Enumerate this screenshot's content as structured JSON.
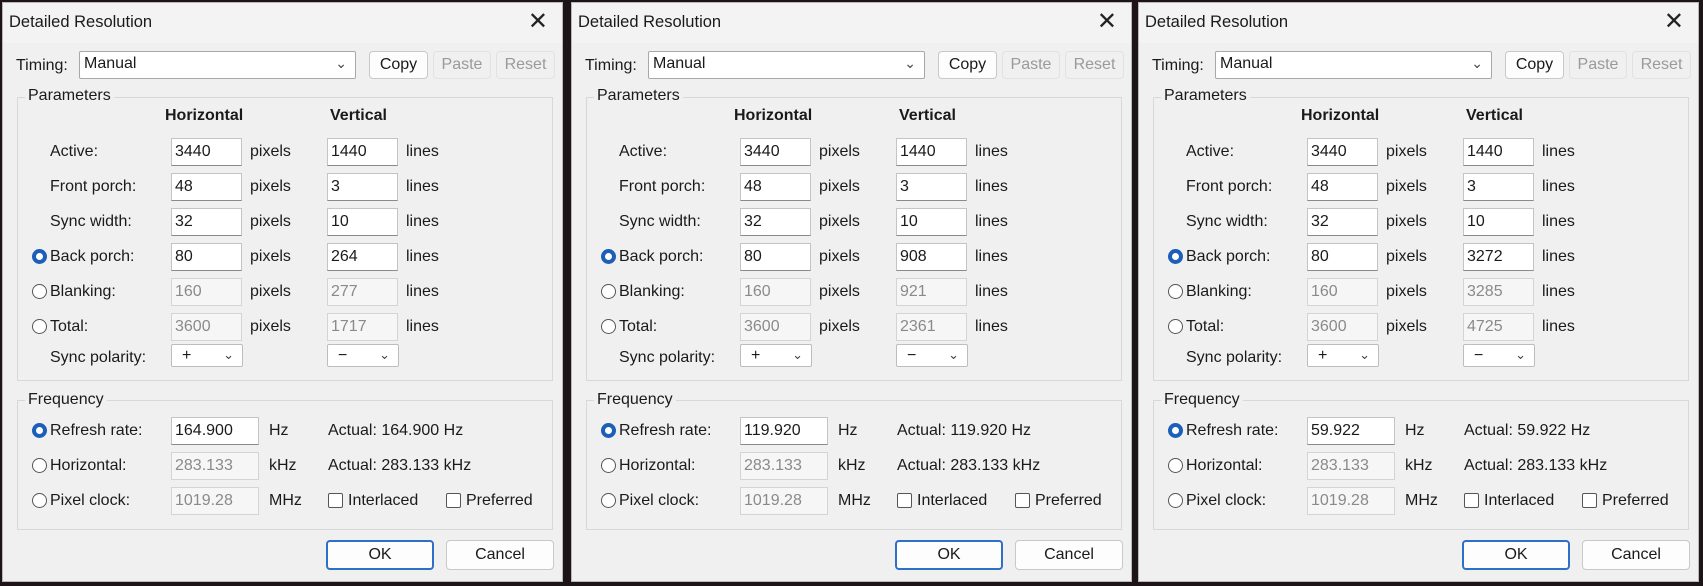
{
  "dialogs": [
    {
      "title": "Detailed Resolution",
      "timing": {
        "label": "Timing:",
        "value": "Manual"
      },
      "buttons": {
        "copy": "Copy",
        "paste": "Paste",
        "reset": "Reset",
        "ok": "OK",
        "cancel": "Cancel"
      },
      "parameters": {
        "title": "Parameters",
        "col_h": "Horizontal",
        "col_v": "Vertical",
        "rows": [
          {
            "label": "Active:",
            "h": "3440",
            "h_unit": "pixels",
            "v": "1440",
            "v_unit": "lines"
          },
          {
            "label": "Front porch:",
            "h": "48",
            "h_unit": "pixels",
            "v": "3",
            "v_unit": "lines"
          },
          {
            "label": "Sync width:",
            "h": "32",
            "h_unit": "pixels",
            "v": "10",
            "v_unit": "lines"
          },
          {
            "label": "Back porch:",
            "h": "80",
            "h_unit": "pixels",
            "v": "264",
            "v_unit": "lines"
          },
          {
            "label": "Blanking:",
            "h": "160",
            "h_unit": "pixels",
            "v": "277",
            "v_unit": "lines"
          },
          {
            "label": "Total:",
            "h": "3600",
            "h_unit": "pixels",
            "v": "1717",
            "v_unit": "lines"
          }
        ],
        "sync_label": "Sync polarity:",
        "sync_h": "+",
        "sync_v": "−"
      },
      "frequency": {
        "title": "Frequency",
        "refresh": {
          "label": "Refresh rate:",
          "value": "164.900",
          "unit": "Hz",
          "actual": "Actual: 164.900 Hz"
        },
        "horizontal": {
          "label": "Horizontal:",
          "value": "283.133",
          "unit": "kHz",
          "actual": "Actual: 283.133 kHz"
        },
        "pixel": {
          "label": "Pixel clock:",
          "value": "1019.28",
          "unit": "MHz"
        },
        "interlaced": "Interlaced",
        "preferred": "Preferred"
      }
    },
    {
      "title": "Detailed Resolution",
      "timing": {
        "label": "Timing:",
        "value": "Manual"
      },
      "buttons": {
        "copy": "Copy",
        "paste": "Paste",
        "reset": "Reset",
        "ok": "OK",
        "cancel": "Cancel"
      },
      "parameters": {
        "title": "Parameters",
        "col_h": "Horizontal",
        "col_v": "Vertical",
        "rows": [
          {
            "label": "Active:",
            "h": "3440",
            "h_unit": "pixels",
            "v": "1440",
            "v_unit": "lines"
          },
          {
            "label": "Front porch:",
            "h": "48",
            "h_unit": "pixels",
            "v": "3",
            "v_unit": "lines"
          },
          {
            "label": "Sync width:",
            "h": "32",
            "h_unit": "pixels",
            "v": "10",
            "v_unit": "lines"
          },
          {
            "label": "Back porch:",
            "h": "80",
            "h_unit": "pixels",
            "v": "908",
            "v_unit": "lines"
          },
          {
            "label": "Blanking:",
            "h": "160",
            "h_unit": "pixels",
            "v": "921",
            "v_unit": "lines"
          },
          {
            "label": "Total:",
            "h": "3600",
            "h_unit": "pixels",
            "v": "2361",
            "v_unit": "lines"
          }
        ],
        "sync_label": "Sync polarity:",
        "sync_h": "+",
        "sync_v": "−"
      },
      "frequency": {
        "title": "Frequency",
        "refresh": {
          "label": "Refresh rate:",
          "value": "119.920",
          "unit": "Hz",
          "actual": "Actual: 119.920 Hz"
        },
        "horizontal": {
          "label": "Horizontal:",
          "value": "283.133",
          "unit": "kHz",
          "actual": "Actual: 283.133 kHz"
        },
        "pixel": {
          "label": "Pixel clock:",
          "value": "1019.28",
          "unit": "MHz"
        },
        "interlaced": "Interlaced",
        "preferred": "Preferred"
      }
    },
    {
      "title": "Detailed Resolution",
      "timing": {
        "label": "Timing:",
        "value": "Manual"
      },
      "buttons": {
        "copy": "Copy",
        "paste": "Paste",
        "reset": "Reset",
        "ok": "OK",
        "cancel": "Cancel"
      },
      "parameters": {
        "title": "Parameters",
        "col_h": "Horizontal",
        "col_v": "Vertical",
        "rows": [
          {
            "label": "Active:",
            "h": "3440",
            "h_unit": "pixels",
            "v": "1440",
            "v_unit": "lines"
          },
          {
            "label": "Front porch:",
            "h": "48",
            "h_unit": "pixels",
            "v": "3",
            "v_unit": "lines"
          },
          {
            "label": "Sync width:",
            "h": "32",
            "h_unit": "pixels",
            "v": "10",
            "v_unit": "lines"
          },
          {
            "label": "Back porch:",
            "h": "80",
            "h_unit": "pixels",
            "v": "3272",
            "v_unit": "lines"
          },
          {
            "label": "Blanking:",
            "h": "160",
            "h_unit": "pixels",
            "v": "3285",
            "v_unit": "lines"
          },
          {
            "label": "Total:",
            "h": "3600",
            "h_unit": "pixels",
            "v": "4725",
            "v_unit": "lines"
          }
        ],
        "sync_label": "Sync polarity:",
        "sync_h": "+",
        "sync_v": "−"
      },
      "frequency": {
        "title": "Frequency",
        "refresh": {
          "label": "Refresh rate:",
          "value": "59.922",
          "unit": "Hz",
          "actual": "Actual: 59.922 Hz"
        },
        "horizontal": {
          "label": "Horizontal:",
          "value": "283.133",
          "unit": "kHz",
          "actual": "Actual: 283.133 kHz"
        },
        "pixel": {
          "label": "Pixel clock:",
          "value": "1019.28",
          "unit": "MHz"
        },
        "interlaced": "Interlaced",
        "preferred": "Preferred"
      }
    }
  ]
}
